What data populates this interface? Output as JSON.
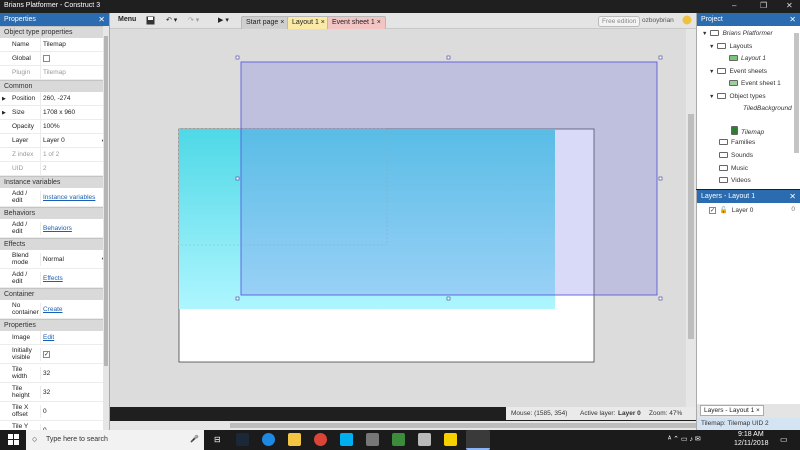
{
  "window": {
    "title": "Brians Platformer - Construct 3",
    "controls": [
      "–",
      "❐",
      "✕"
    ]
  },
  "properties": {
    "header": "Properties",
    "sections": [
      {
        "title": "Object type properties",
        "rows": [
          {
            "key": "Name",
            "value": "Tilemap"
          },
          {
            "key": "Global",
            "value": ""
          },
          {
            "key": "Plugin",
            "value": "Tilemap",
            "dim": true
          }
        ]
      },
      {
        "title": "Common",
        "rows": [
          {
            "key": "Position",
            "value": "260, -274"
          },
          {
            "key": "Size",
            "value": "1708 x 960"
          },
          {
            "key": "Opacity",
            "value": "100%"
          },
          {
            "key": "Layer",
            "value": "Layer 0"
          },
          {
            "key": "Z index",
            "value": "1 of 2",
            "dim": true
          },
          {
            "key": "UID",
            "value": "2",
            "dim": true
          }
        ]
      },
      {
        "title": "Instance variables",
        "rows": [
          {
            "key": "Add / edit",
            "value": "Instance variables",
            "link": true
          }
        ]
      },
      {
        "title": "Behaviors",
        "rows": [
          {
            "key": "Add / edit",
            "value": "Behaviors",
            "link": true
          }
        ]
      },
      {
        "title": "Effects",
        "rows": [
          {
            "key": "Blend mode",
            "value": "Normal"
          },
          {
            "key": "Add / edit",
            "value": "Effects",
            "link": true
          }
        ]
      },
      {
        "title": "Container",
        "rows": [
          {
            "key": "No container",
            "value": "Create",
            "link": true
          }
        ]
      },
      {
        "title": "Properties",
        "rows": [
          {
            "key": "Image",
            "value": "Edit",
            "link": true
          },
          {
            "key": "Initially visible",
            "value": "✓"
          },
          {
            "key": "Tile width",
            "value": "32"
          },
          {
            "key": "Tile height",
            "value": "32"
          },
          {
            "key": "Tile X offset",
            "value": "0"
          },
          {
            "key": "Tile Y offset",
            "value": "0"
          }
        ]
      }
    ]
  },
  "toolbar": {
    "menu": "Menu",
    "tabs": [
      {
        "label": "Start page ×"
      },
      {
        "label": "Layout 1 ×"
      },
      {
        "label": "Event sheet 1 ×"
      }
    ],
    "edition": "Free edition",
    "user": "ozboybrian"
  },
  "status": {
    "mouse": "Mouse: (1585, 354)",
    "active_layer_label": "Active layer:",
    "active_layer": "Layer 0",
    "zoom": "Zoom: 47%"
  },
  "project": {
    "header": "Project",
    "items": [
      {
        "label": "Brians Platformer",
        "type": "folder"
      },
      {
        "label": "Layouts",
        "type": "folder"
      },
      {
        "label": "Layout 1",
        "type": "layout"
      },
      {
        "label": "Event sheets",
        "type": "folder"
      },
      {
        "label": "Event sheet 1",
        "type": "sheet"
      },
      {
        "label": "Object types",
        "type": "folder"
      },
      {
        "label": "TiledBackground",
        "type": "object"
      },
      {
        "label": "Tilemap",
        "type": "object"
      },
      {
        "label": "Families",
        "type": "folder"
      },
      {
        "label": "Sounds",
        "type": "folder"
      },
      {
        "label": "Music",
        "type": "folder"
      },
      {
        "label": "Videos",
        "type": "folder"
      }
    ]
  },
  "layers": {
    "header": "Layers - Layout 1",
    "items": [
      {
        "name": "Layer 0",
        "index": "0"
      }
    ],
    "bottom_tab": "Layers - Layout 1 ×",
    "bottom_status": "Tilemap: Tilemap UID 2"
  },
  "taskbar": {
    "search_placeholder": "Type here to search",
    "time": "9:18 AM",
    "date": "12/11/2018"
  }
}
